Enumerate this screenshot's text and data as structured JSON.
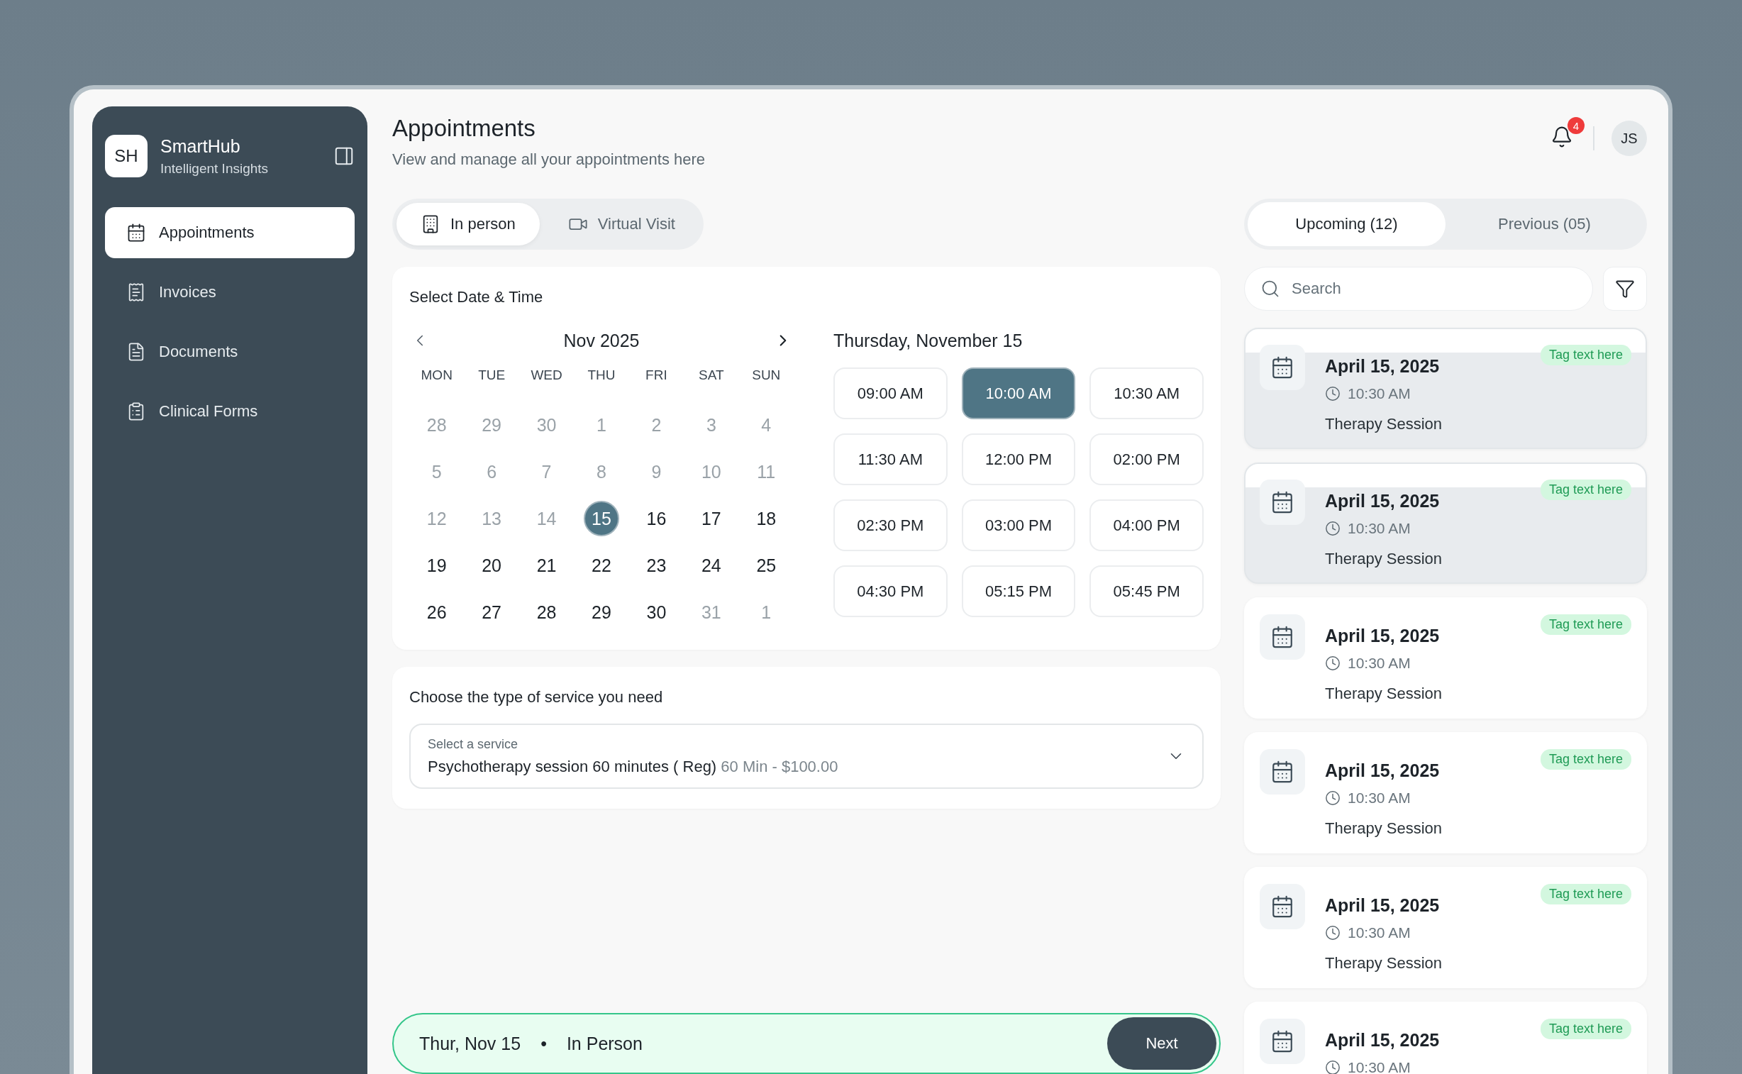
{
  "brand": {
    "initials": "SH",
    "name": "SmartHub",
    "tagline": "Intelligent Insights"
  },
  "nav": [
    {
      "label": "Appointments",
      "selected": true
    },
    {
      "label": "Invoices",
      "selected": false
    },
    {
      "label": "Documents",
      "selected": false
    },
    {
      "label": "Clinical Forms",
      "selected": false
    }
  ],
  "header": {
    "title": "Appointments",
    "subtitle": "View and manage all your appointments here",
    "notifications": "4",
    "avatar": "JS"
  },
  "visit_tabs": [
    {
      "label": "In person",
      "selected": true
    },
    {
      "label": "Virtual Visit",
      "selected": false
    }
  ],
  "schedule": {
    "heading": "Select Date &  Time",
    "month": "Nov 2025",
    "weekdays": [
      "MON",
      "TUE",
      "WED",
      "THU",
      "FRI",
      "SAT",
      "SUN"
    ],
    "days": [
      {
        "label": "28",
        "muted": true,
        "selected": false
      },
      {
        "label": "29",
        "muted": true,
        "selected": false
      },
      {
        "label": "30",
        "muted": true,
        "selected": false
      },
      {
        "label": "1",
        "muted": true,
        "selected": false
      },
      {
        "label": "2",
        "muted": true,
        "selected": false
      },
      {
        "label": "3",
        "muted": true,
        "selected": false
      },
      {
        "label": "4",
        "muted": true,
        "selected": false
      },
      {
        "label": "5",
        "muted": true,
        "selected": false
      },
      {
        "label": "6",
        "muted": true,
        "selected": false
      },
      {
        "label": "7",
        "muted": true,
        "selected": false
      },
      {
        "label": "8",
        "muted": true,
        "selected": false
      },
      {
        "label": "9",
        "muted": true,
        "selected": false
      },
      {
        "label": "10",
        "muted": true,
        "selected": false
      },
      {
        "label": "11",
        "muted": true,
        "selected": false
      },
      {
        "label": "12",
        "muted": true,
        "selected": false
      },
      {
        "label": "13",
        "muted": true,
        "selected": false
      },
      {
        "label": "14",
        "muted": true,
        "selected": false
      },
      {
        "label": "15",
        "muted": false,
        "selected": true
      },
      {
        "label": "16",
        "muted": false,
        "selected": false
      },
      {
        "label": "17",
        "muted": false,
        "selected": false
      },
      {
        "label": "18",
        "muted": false,
        "selected": false
      },
      {
        "label": "19",
        "muted": false,
        "selected": false
      },
      {
        "label": "20",
        "muted": false,
        "selected": false
      },
      {
        "label": "21",
        "muted": false,
        "selected": false
      },
      {
        "label": "22",
        "muted": false,
        "selected": false
      },
      {
        "label": "23",
        "muted": false,
        "selected": false
      },
      {
        "label": "24",
        "muted": false,
        "selected": false
      },
      {
        "label": "25",
        "muted": false,
        "selected": false
      },
      {
        "label": "26",
        "muted": false,
        "selected": false
      },
      {
        "label": "27",
        "muted": false,
        "selected": false
      },
      {
        "label": "28",
        "muted": false,
        "selected": false
      },
      {
        "label": "29",
        "muted": false,
        "selected": false
      },
      {
        "label": "30",
        "muted": false,
        "selected": false
      },
      {
        "label": "31",
        "muted": true,
        "selected": false
      },
      {
        "label": "1",
        "muted": true,
        "selected": false
      }
    ],
    "day_title": "Thursday, November 15",
    "times": [
      {
        "label": "09:00 AM",
        "selected": false
      },
      {
        "label": "10:00 AM",
        "selected": true
      },
      {
        "label": "10:30 AM",
        "selected": false
      },
      {
        "label": "11:30 AM",
        "selected": false
      },
      {
        "label": "12:00 PM",
        "selected": false
      },
      {
        "label": "02:00 PM",
        "selected": false
      },
      {
        "label": "02:30 PM",
        "selected": false
      },
      {
        "label": "03:00 PM",
        "selected": false
      },
      {
        "label": "04:00 PM",
        "selected": false
      },
      {
        "label": "04:30 PM",
        "selected": false
      },
      {
        "label": "05:15 PM",
        "selected": false
      },
      {
        "label": "05:45 PM",
        "selected": false
      }
    ]
  },
  "service": {
    "heading": "Choose the type of service you need",
    "label": "Select a service",
    "value": "Psychotherapy session 60 minutes ( Reg)",
    "detail": "60 Min -  $100.00"
  },
  "summary": {
    "date": "Thur, Nov 15",
    "separator": "•",
    "mode": "In Person",
    "button": "Next"
  },
  "list_tabs": [
    {
      "label": "Upcoming (12)",
      "selected": true
    },
    {
      "label": "Previous (05)",
      "selected": false
    }
  ],
  "search": {
    "placeholder": "Search"
  },
  "appointments": [
    {
      "date": "April 15, 2025",
      "time": "10:30 AM",
      "title": "Therapy Session",
      "tag": "Tag text here",
      "highlighted": true
    },
    {
      "date": "April 15, 2025",
      "time": "10:30 AM",
      "title": "Therapy Session",
      "tag": "Tag text here",
      "highlighted": true
    },
    {
      "date": "April 15, 2025",
      "time": "10:30 AM",
      "title": "Therapy Session",
      "tag": "Tag text here",
      "highlighted": false
    },
    {
      "date": "April 15, 2025",
      "time": "10:30 AM",
      "title": "Therapy Session",
      "tag": "Tag text here",
      "highlighted": false
    },
    {
      "date": "April 15, 2025",
      "time": "10:30 AM",
      "title": "Therapy Session",
      "tag": "Tag text here",
      "highlighted": false
    },
    {
      "date": "April 15, 2025",
      "time": "10:30 AM",
      "tag": "Tag text here",
      "highlighted": false
    }
  ]
}
